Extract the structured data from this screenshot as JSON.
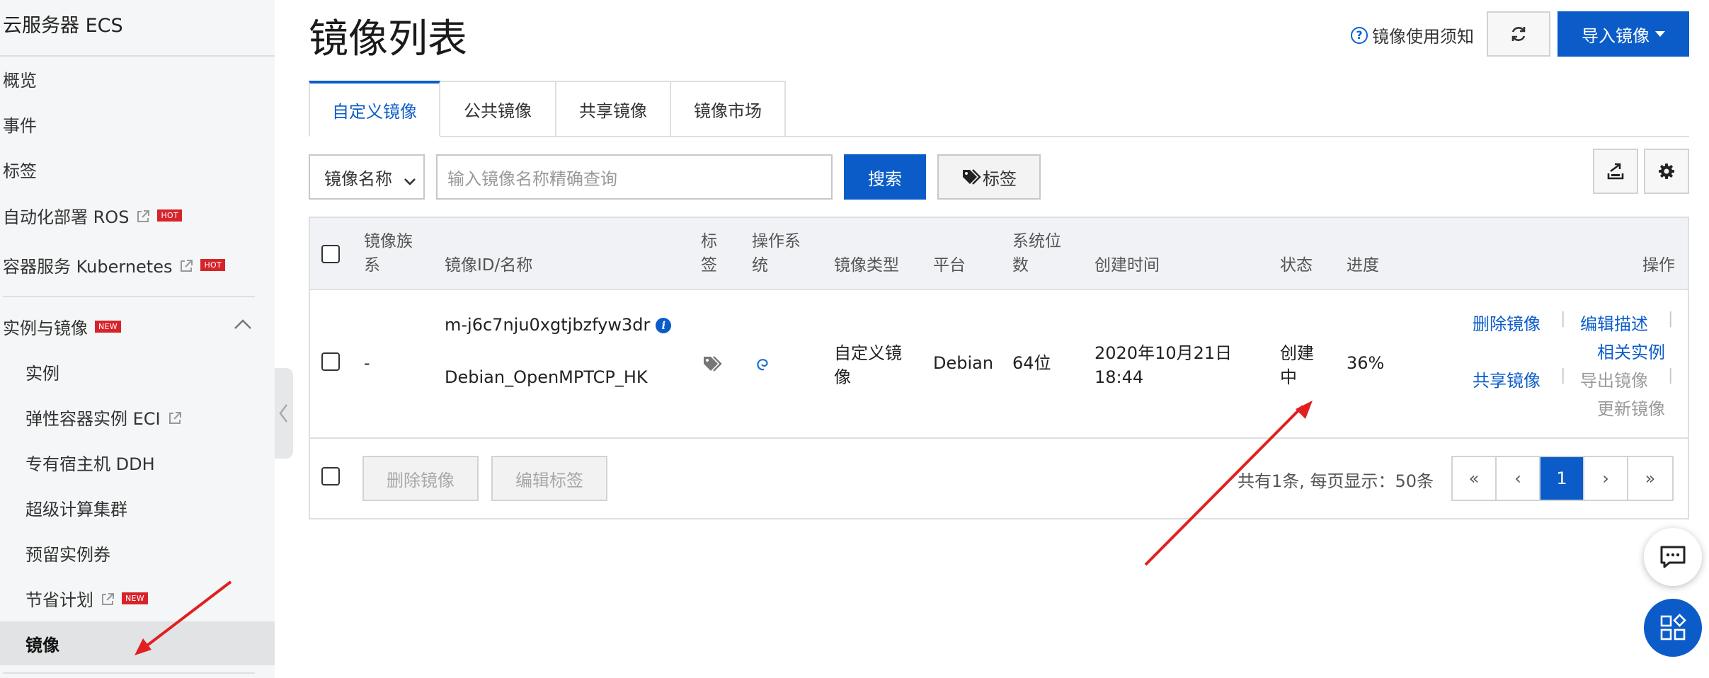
{
  "sidebar": {
    "title": "云服务器 ECS",
    "items": [
      {
        "label": "概览"
      },
      {
        "label": "事件"
      },
      {
        "label": "标签"
      },
      {
        "label": "自动化部署 ROS",
        "badge": "HOT",
        "external": true
      },
      {
        "label": "容器服务 Kubernetes",
        "badge": "HOT",
        "external": true
      }
    ],
    "section": {
      "label": "实例与镜像",
      "badge": "NEW",
      "expanded": true
    },
    "sub_items": [
      {
        "label": "实例"
      },
      {
        "label": "弹性容器实例 ECI",
        "external": true
      },
      {
        "label": "专有宿主机 DDH"
      },
      {
        "label": "超级计算集群"
      },
      {
        "label": "预留实例券"
      },
      {
        "label": "节省计划",
        "badge": "NEW",
        "external": true
      },
      {
        "label": "镜像",
        "active": true
      }
    ]
  },
  "header": {
    "title": "镜像列表",
    "notice_label": "镜像使用须知",
    "refresh_icon": "refresh-icon",
    "import_label": "导入镜像"
  },
  "tabs": [
    {
      "label": "自定义镜像",
      "active": true
    },
    {
      "label": "公共镜像"
    },
    {
      "label": "共享镜像"
    },
    {
      "label": "镜像市场"
    }
  ],
  "filter": {
    "select_value": "镜像名称",
    "search_placeholder": "输入镜像名称精确查询",
    "search_label": "搜索",
    "tag_label": "标签"
  },
  "table": {
    "columns": {
      "family": "镜像族系",
      "id_name": "镜像ID/名称",
      "tag": "标签",
      "os": "操作系统",
      "type": "镜像类型",
      "platform": "平台",
      "bits": "系统位数",
      "created": "创建时间",
      "status": "状态",
      "progress": "进度",
      "actions": "操作"
    },
    "rows": [
      {
        "family": "-",
        "image_id": "m-j6c7nju0xgtjbzfyw3dr",
        "image_name": "Debian_OpenMPTCP_HK",
        "type": "自定义镜像",
        "platform": "Debian",
        "bits": "64位",
        "created": "2020年10月21日 18:44",
        "status": "创建中",
        "progress": "36%",
        "actions": {
          "delete": "删除镜像",
          "edit_desc": "编辑描述",
          "related": "相关实例",
          "share": "共享镜像",
          "export": "导出镜像",
          "update": "更新镜像"
        }
      }
    ]
  },
  "footer": {
    "delete_label": "删除镜像",
    "edit_tags_label": "编辑标签",
    "total_text": "共有1条, 每页显示：50条",
    "pager": {
      "first": "«",
      "prev": "‹",
      "current": "1",
      "next": "›",
      "last": "»"
    }
  },
  "colors": {
    "primary": "#0b5cc9",
    "badge": "#d7242b",
    "arrow": "#e02020"
  }
}
